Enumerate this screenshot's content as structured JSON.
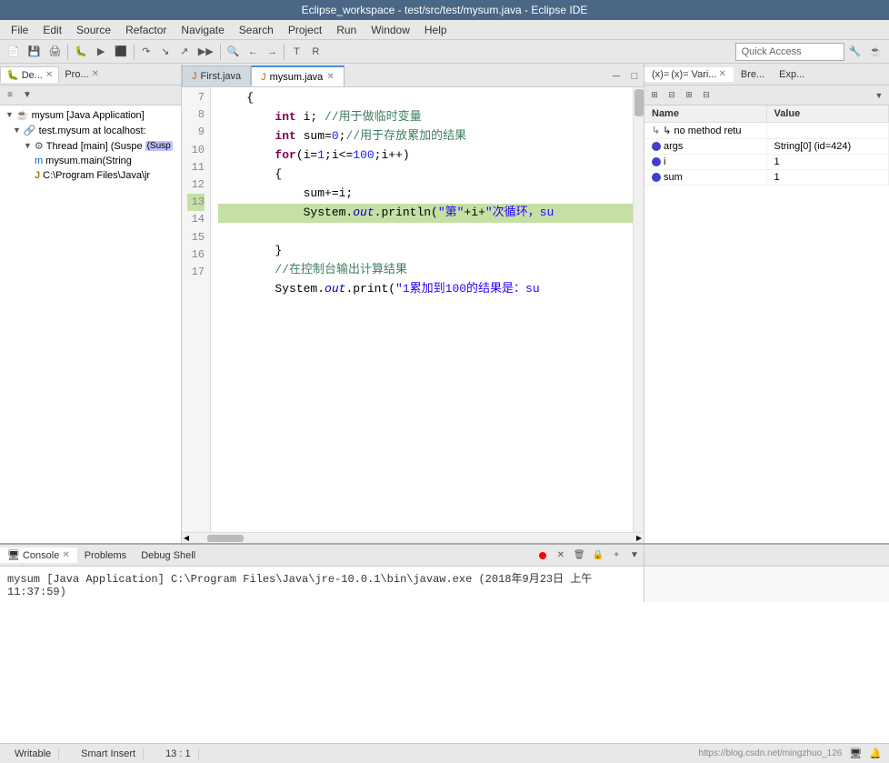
{
  "title_bar": {
    "text": "Eclipse_workspace - test/src/test/mysum.java - Eclipse IDE"
  },
  "menu": {
    "items": [
      "File",
      "Edit",
      "Source",
      "Refactor",
      "Navigate",
      "Search",
      "Project",
      "Run",
      "Window",
      "Help"
    ]
  },
  "toolbar": {
    "quick_access_placeholder": "Quick Access"
  },
  "left_panel": {
    "tabs": [
      {
        "label": "De...",
        "active": false,
        "closeable": true
      },
      {
        "label": "Pro...",
        "active": false,
        "closeable": true
      }
    ],
    "tree": [
      {
        "level": 0,
        "icon": "expand",
        "text": "mysum [Java Application]"
      },
      {
        "level": 1,
        "icon": "expand",
        "text": "test.mysum at localhost:"
      },
      {
        "level": 2,
        "icon": "expand",
        "text": "Thread [main] (Suspe"
      },
      {
        "level": 3,
        "icon": "method",
        "text": "mysum.main(String"
      },
      {
        "level": 3,
        "icon": "java",
        "text": "C:\\Program Files\\Java\\jr"
      }
    ]
  },
  "editor": {
    "tabs": [
      {
        "label": "First.java",
        "active": false,
        "closeable": false
      },
      {
        "label": "mysum.java",
        "active": true,
        "closeable": true
      }
    ],
    "lines": [
      {
        "num": 7,
        "text": "    {",
        "highlight": false
      },
      {
        "num": 8,
        "text": "        int i; //用于做临时变量",
        "highlight": false
      },
      {
        "num": 9,
        "text": "        int sum=0;//用于存放累加的结果",
        "highlight": false
      },
      {
        "num": 10,
        "text": "        for(i=1;i<=100;i++)",
        "highlight": false
      },
      {
        "num": 11,
        "text": "        {",
        "highlight": false
      },
      {
        "num": 12,
        "text": "            sum+=i;",
        "highlight": false
      },
      {
        "num": 13,
        "text": "            System.out.println(\"第\"+i+\"次循环，su",
        "highlight": true
      },
      {
        "num": 14,
        "text": "",
        "highlight": false
      },
      {
        "num": 15,
        "text": "        }",
        "highlight": false
      },
      {
        "num": 16,
        "text": "        //在控制台输出计算结果",
        "highlight": false
      },
      {
        "num": 17,
        "text": "        System.out.print(\"1累加到100的结果是：su",
        "highlight": false
      }
    ]
  },
  "right_panel": {
    "tabs": [
      {
        "label": "(x)= Vari...",
        "active": true,
        "closeable": true
      },
      {
        "label": "Bre...",
        "active": false,
        "closeable": false
      },
      {
        "label": "Exp...",
        "active": false,
        "closeable": false
      }
    ],
    "table": {
      "headers": [
        "Name",
        "Value"
      ],
      "rows": [
        {
          "name": "↳ no method retu",
          "value": "",
          "icon": "arrow"
        },
        {
          "name": "args",
          "value": "String[0]  (id=424)",
          "icon": "blue"
        },
        {
          "name": "i",
          "value": "1",
          "icon": "blue"
        },
        {
          "name": "sum",
          "value": "1",
          "icon": "blue"
        }
      ]
    }
  },
  "bottom_panel": {
    "tabs": [
      {
        "label": "Console",
        "active": true,
        "closeable": true
      },
      {
        "label": "Problems",
        "active": false,
        "closeable": false
      },
      {
        "label": "Debug Shell",
        "active": false,
        "closeable": false
      }
    ],
    "console_text": "mysum [Java Application] C:\\Program Files\\Java\\jre-10.0.1\\bin\\javaw.exe (2018年9月23日 上午11:37:59)"
  },
  "status_bar": {
    "writable": "Writable",
    "insert_mode": "Smart Insert",
    "position": "13 : 1",
    "watermark": "https://blog.csdn.net/mingzhuo_126"
  }
}
